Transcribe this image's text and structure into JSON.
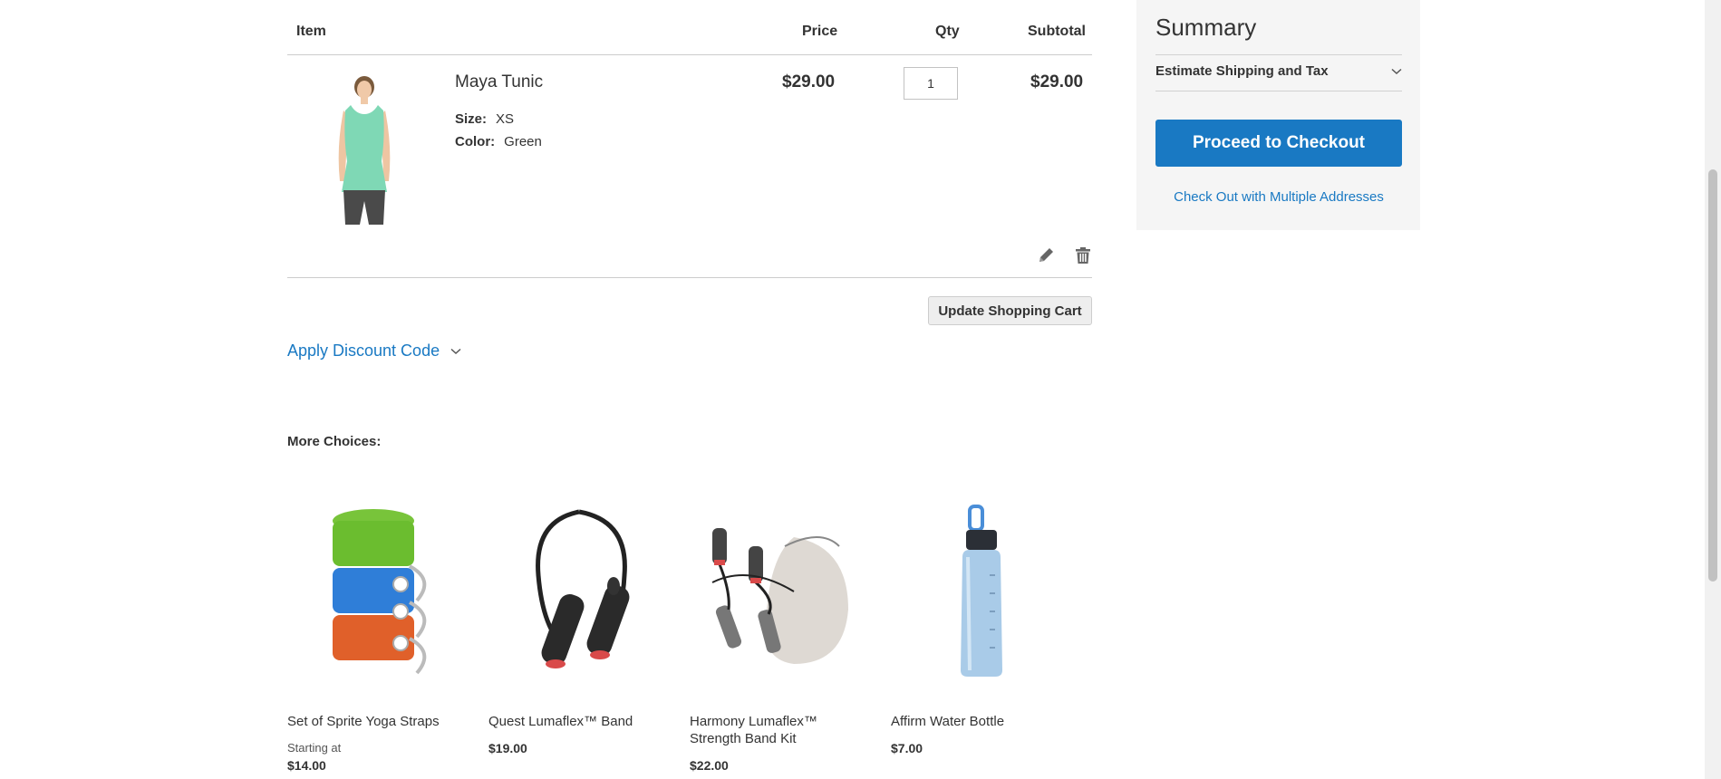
{
  "cart": {
    "headers": {
      "item": "Item",
      "price": "Price",
      "qty": "Qty",
      "subtotal": "Subtotal"
    },
    "item": {
      "name": "Maya Tunic",
      "options": [
        {
          "label": "Size:",
          "value": "XS"
        },
        {
          "label": "Color:",
          "value": "Green"
        }
      ],
      "price": "$29.00",
      "qty": "1",
      "subtotal": "$29.00",
      "actions": [
        "pencil-icon",
        "trash-icon"
      ]
    },
    "update_label": "Update Shopping Cart",
    "discount_label": "Apply Discount Code"
  },
  "more_choices": {
    "title": "More Choices:",
    "items": [
      {
        "name": "Set of Sprite Yoga Straps",
        "starting": "Starting at",
        "price": "$14.00"
      },
      {
        "name": "Quest Lumaflex™ Band",
        "price": "$19.00"
      },
      {
        "name": "Harmony Lumaflex™ Strength Band Kit",
        "price": "$22.00"
      },
      {
        "name": "Affirm Water Bottle",
        "price": "$7.00"
      }
    ]
  },
  "summary": {
    "title": "Summary",
    "shipping_label": "Estimate Shipping and Tax",
    "checkout_label": "Proceed to Checkout",
    "multi_label": "Check Out with Multiple Addresses"
  },
  "colors": {
    "accent": "#1979c3",
    "panel": "#f5f5f5",
    "text": "#333333"
  }
}
